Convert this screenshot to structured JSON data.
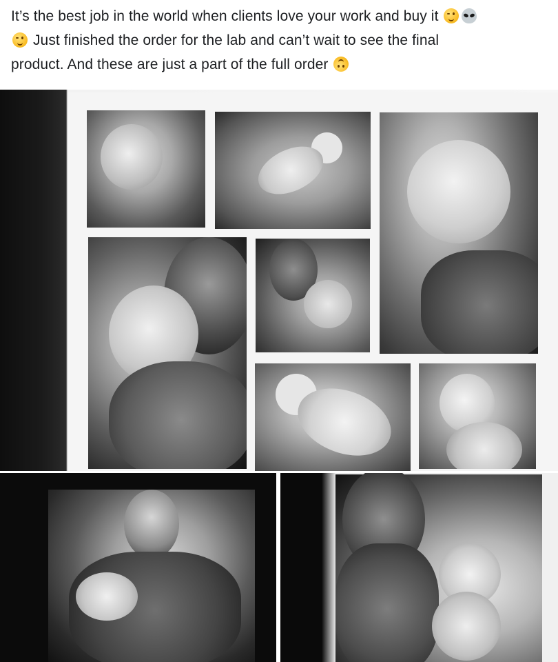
{
  "post": {
    "line1_text": "It’s the best job in the world when clients love your work and buy it",
    "line2_text": "Just finished the order for the lab and can’t wait to see the final",
    "line3_text": "product. And these are just a part of the full order",
    "emojis": [
      "winking-face",
      "alien",
      "winking-face",
      "upside-down-face"
    ]
  },
  "photos": {
    "collage_alt": "collage-print",
    "bottom_left_alt": "print-father-holding-baby",
    "bottom_right_alt": "print-father-lifting-baby"
  }
}
